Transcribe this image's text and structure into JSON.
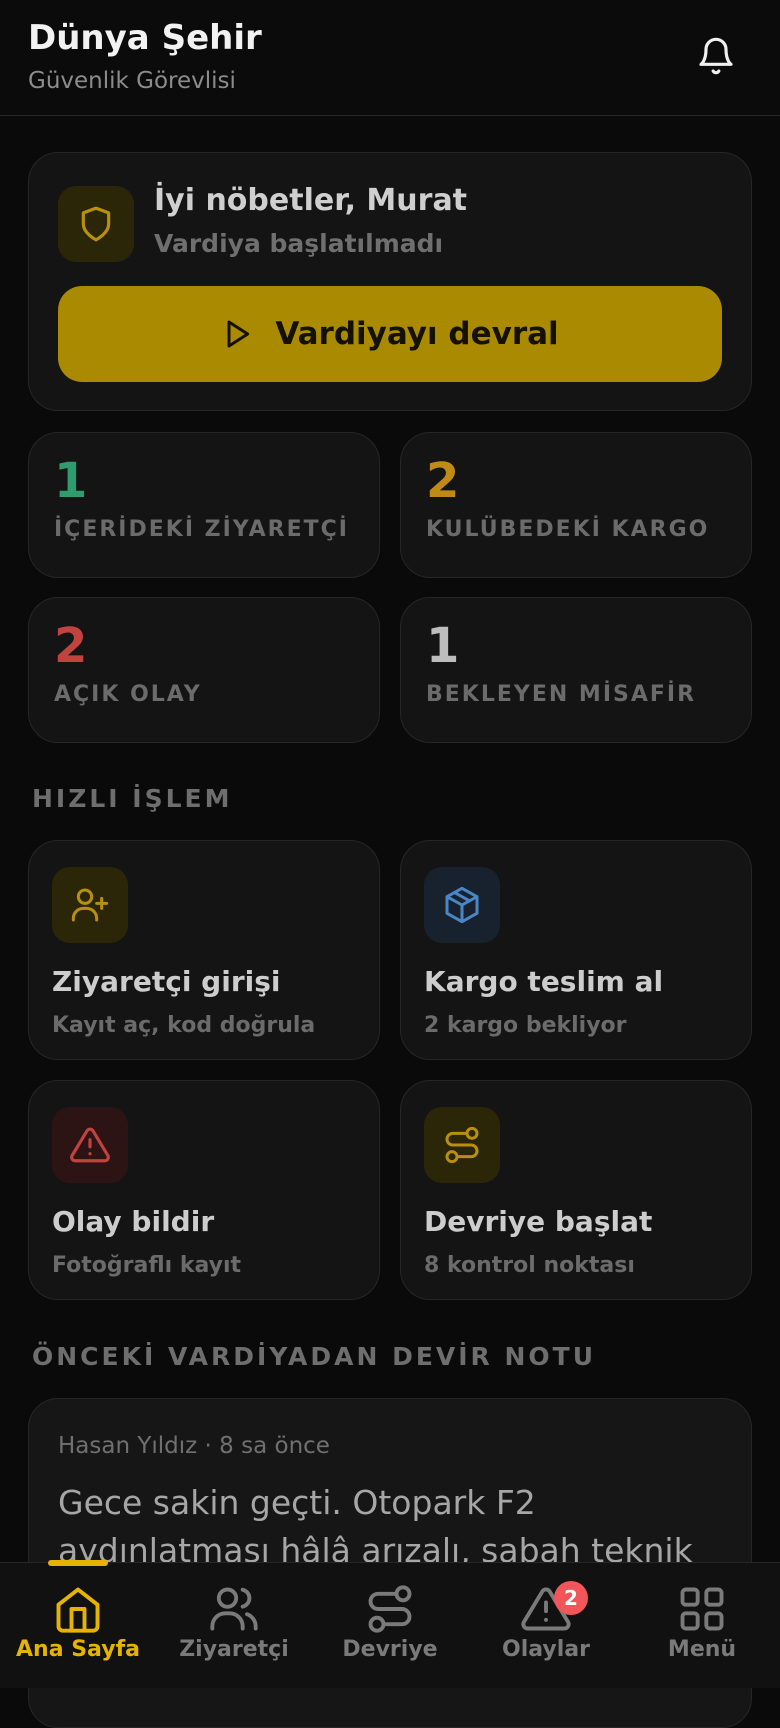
{
  "header": {
    "title": "Dünya Şehir",
    "subtitle": "Güvenlik Görevlisi"
  },
  "welcome": {
    "greeting": "İyi nöbetler, Murat",
    "status": "Vardiya başlatılmadı",
    "button_label": "Vardiyayı devral"
  },
  "stats": [
    {
      "value": "1",
      "label": "İÇERİDEKİ ZİYARETÇİ",
      "color": "#2f9c6e"
    },
    {
      "value": "2",
      "label": "KULÜBEDEKİ KARGO",
      "color": "#c08a16"
    },
    {
      "value": "2",
      "label": "AÇIK OLAY",
      "color": "#c0433f"
    },
    {
      "value": "1",
      "label": "BEKLEYEN MİSAFİR",
      "color": "#bdbdbd"
    }
  ],
  "quick_actions": {
    "title": "HIZLI İŞLEM",
    "items": [
      {
        "title": "Ziyaretçi girişi",
        "subtitle": "Kayıt aç, kod doğrula",
        "icon": "user-plus-icon"
      },
      {
        "title": "Kargo teslim al",
        "subtitle": "2 kargo bekliyor",
        "icon": "package-icon"
      },
      {
        "title": "Olay bildir",
        "subtitle": "Fotoğraflı kayıt",
        "icon": "alert-triangle-icon"
      },
      {
        "title": "Devriye başlat",
        "subtitle": "8 kontrol noktası",
        "icon": "route-icon"
      }
    ]
  },
  "handover": {
    "title": "ÖNCEKİ VARDİYADAN DEVİR NOTU",
    "author_time": "Hasan Yıldız · 8 sa önce",
    "text": "Gece sakin geçti. Otopark F2 aydınlatması hâlâ arızalı, sabah teknik"
  },
  "nav": {
    "items": [
      {
        "label": "Ana Sayfa",
        "icon": "home-icon"
      },
      {
        "label": "Ziyaretçi",
        "icon": "users-icon"
      },
      {
        "label": "Devriye",
        "icon": "route-icon"
      },
      {
        "label": "Olaylar",
        "icon": "alert-triangle-icon"
      },
      {
        "label": "Menü",
        "icon": "grid-icon"
      }
    ],
    "incidents_badge": "2"
  },
  "colors": {
    "accent": "#e6b400",
    "button": "#a98a00",
    "danger": "#f2555a"
  }
}
